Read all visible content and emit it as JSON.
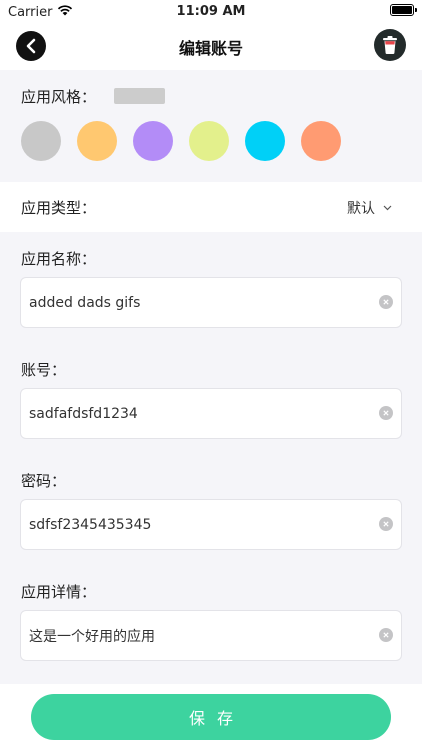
{
  "status": {
    "carrier": "Carrier",
    "time": "11:09 AM"
  },
  "nav": {
    "title": "编辑账号"
  },
  "style": {
    "label": "应用风格：",
    "selected_color": "#cccccc",
    "swatches": [
      "#c8c8c8",
      "#ffc870",
      "#b38cf7",
      "#e3f08c",
      "#00d0f7",
      "#ff9b72"
    ]
  },
  "app_type": {
    "label": "应用类型：",
    "value": "默认"
  },
  "fields": {
    "name": {
      "label": "应用名称：",
      "value": "added dads gifs"
    },
    "account": {
      "label": "账号：",
      "value": "sadfafdsfd1234"
    },
    "password": {
      "label": "密码：",
      "value": "sdfsf2345435345"
    },
    "detail": {
      "label": "应用详情：",
      "value": "这是一个好用的应用"
    }
  },
  "save_label": "保存",
  "colors": {
    "accent": "#3dd39f",
    "background": "#f5f5f9"
  }
}
